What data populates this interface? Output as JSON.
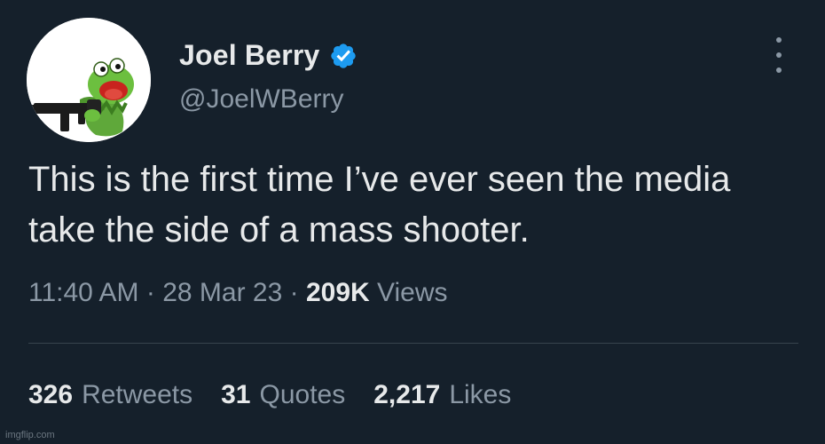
{
  "tweet": {
    "author": {
      "display_name": "Joel Berry",
      "handle": "@JoelWBerry",
      "verified": true,
      "avatar_icon": "kermit-with-gun-avatar"
    },
    "text": "This is the first time I’ve ever seen the media take the side of a mass shooter.",
    "time": "11:40 AM",
    "separator": "·",
    "date": "28 Mar 23",
    "views_count": "209K",
    "views_label": "Views",
    "stats": {
      "retweets_count": "326",
      "retweets_label": "Retweets",
      "quotes_count": "31",
      "quotes_label": "Quotes",
      "likes_count": "2,217",
      "likes_label": "Likes"
    }
  },
  "watermark": "imgflip.com",
  "colors": {
    "background": "#15202b",
    "primary_text": "#e7e9ea",
    "secondary_text": "#8b98a5",
    "verified_blue": "#1d9bf0",
    "divider": "#38444d"
  },
  "icons": {
    "verified": "verified-badge-icon",
    "more": "more-options-icon"
  }
}
